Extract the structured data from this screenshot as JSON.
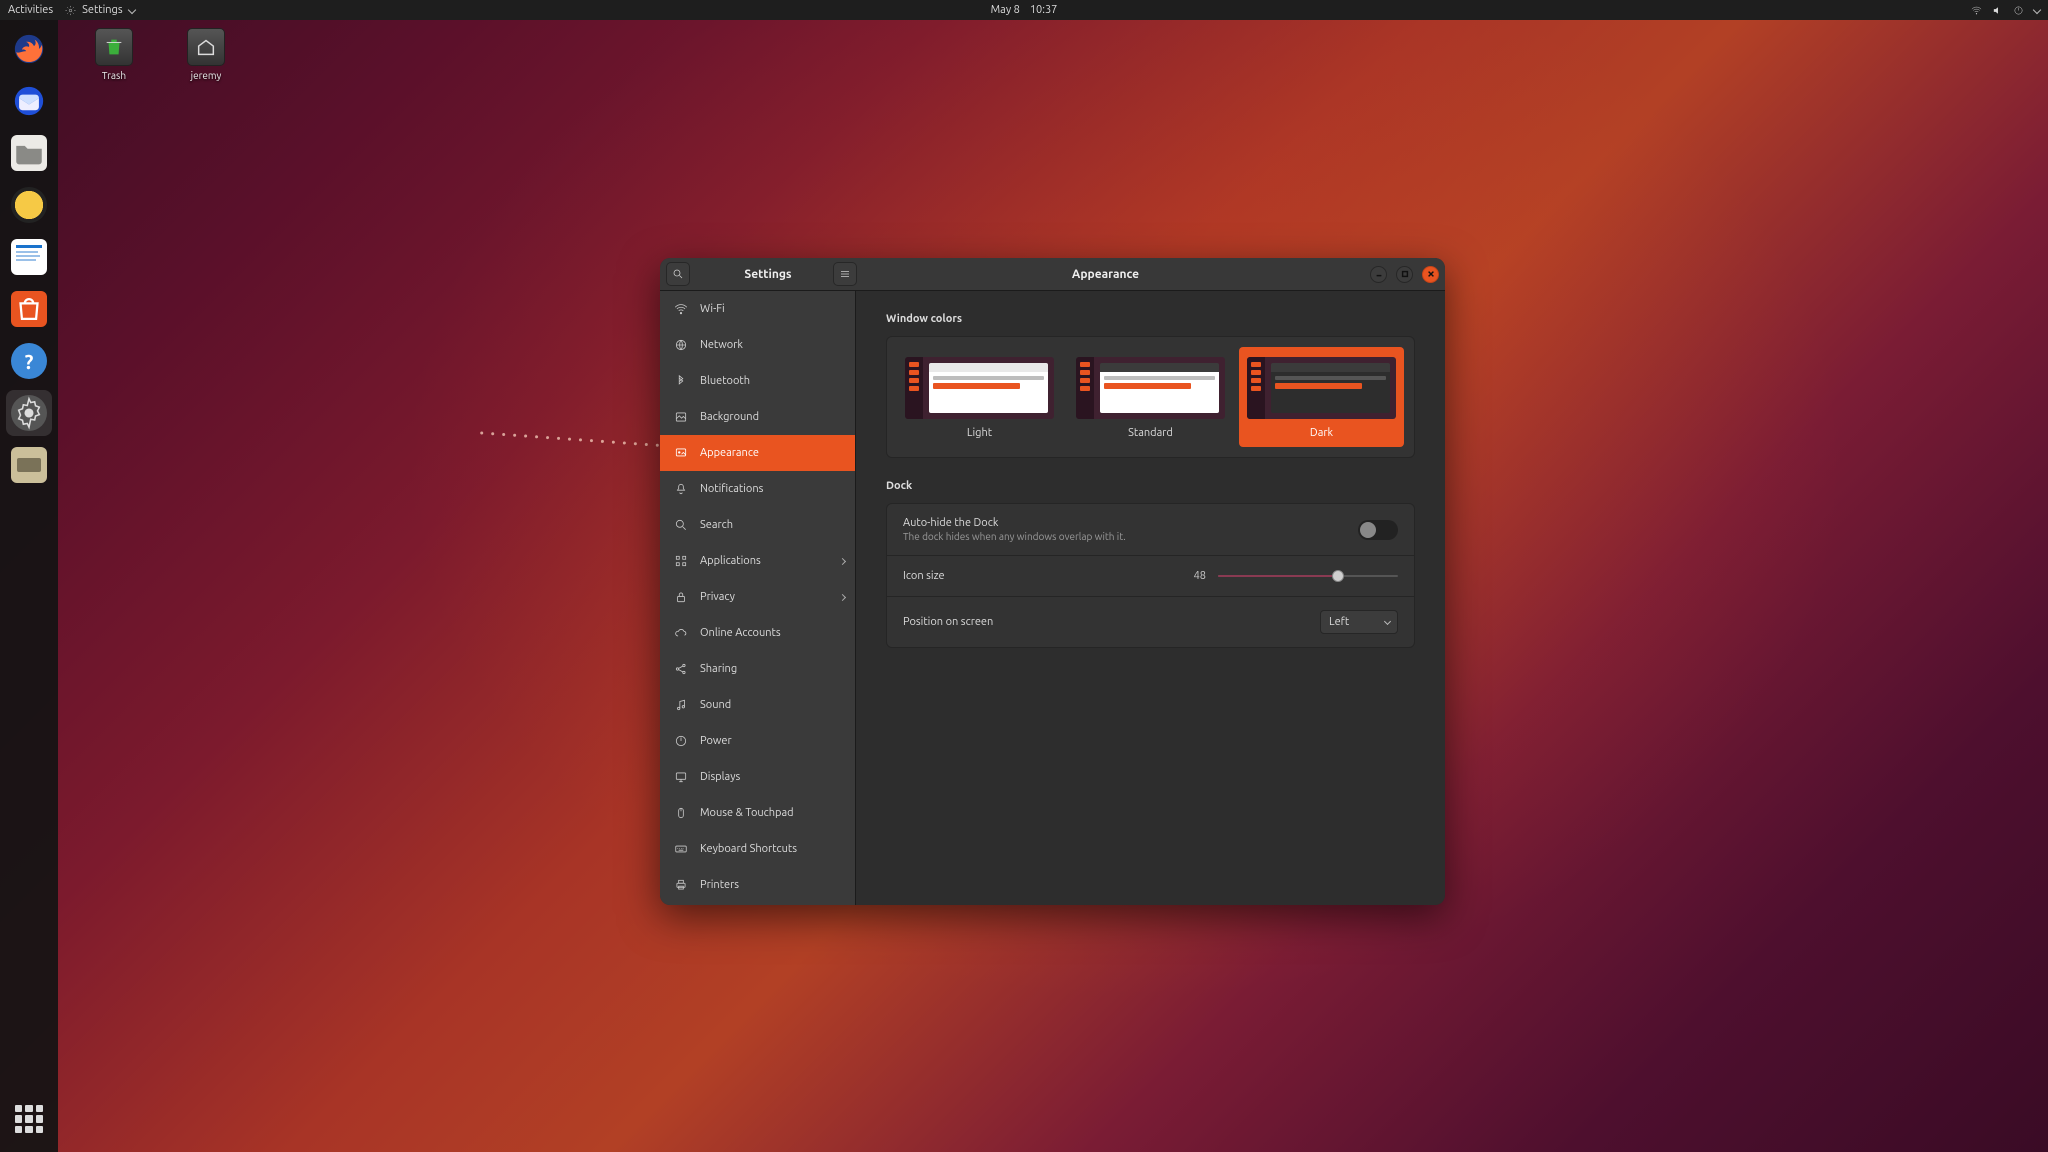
{
  "topbar": {
    "activities": "Activities",
    "app_name": "Settings",
    "date": "May 8",
    "time": "10:37"
  },
  "desktop_icons": {
    "trash": "Trash",
    "home": "jeremy"
  },
  "window": {
    "title_left": "Settings",
    "title_right": "Appearance"
  },
  "sidebar": {
    "items": [
      {
        "id": "wifi",
        "label": "Wi-Fi",
        "icon": "wifi"
      },
      {
        "id": "network",
        "label": "Network",
        "icon": "net"
      },
      {
        "id": "bluetooth",
        "label": "Bluetooth",
        "icon": "bt"
      },
      {
        "id": "background",
        "label": "Background",
        "icon": "bg"
      },
      {
        "id": "appearance",
        "label": "Appearance",
        "icon": "appear",
        "selected": true
      },
      {
        "id": "notifications",
        "label": "Notifications",
        "icon": "bell"
      },
      {
        "id": "search",
        "label": "Search",
        "icon": "search"
      },
      {
        "id": "applications",
        "label": "Applications",
        "icon": "grid",
        "expandable": true
      },
      {
        "id": "privacy",
        "label": "Privacy",
        "icon": "lock",
        "expandable": true
      },
      {
        "id": "online",
        "label": "Online Accounts",
        "icon": "cloud"
      },
      {
        "id": "sharing",
        "label": "Sharing",
        "icon": "share"
      },
      {
        "id": "sound",
        "label": "Sound",
        "icon": "note"
      },
      {
        "id": "power",
        "label": "Power",
        "icon": "power"
      },
      {
        "id": "displays",
        "label": "Displays",
        "icon": "display"
      },
      {
        "id": "mouse",
        "label": "Mouse & Touchpad",
        "icon": "mouse"
      },
      {
        "id": "keyboard",
        "label": "Keyboard Shortcuts",
        "icon": "kbd"
      },
      {
        "id": "printers",
        "label": "Printers",
        "icon": "printer"
      }
    ]
  },
  "appearance": {
    "window_colors_title": "Window colors",
    "themes": [
      {
        "id": "light",
        "label": "Light"
      },
      {
        "id": "standard",
        "label": "Standard"
      },
      {
        "id": "dark",
        "label": "Dark",
        "selected": true
      }
    ],
    "dock_title": "Dock",
    "autohide_label": "Auto-hide the Dock",
    "autohide_sub": "The dock hides when any windows overlap with it.",
    "autohide_on": false,
    "iconsize_label": "Icon size",
    "iconsize_value": "48",
    "iconsize_min": 16,
    "iconsize_max": 64,
    "position_label": "Position on screen",
    "position_value": "Left"
  }
}
